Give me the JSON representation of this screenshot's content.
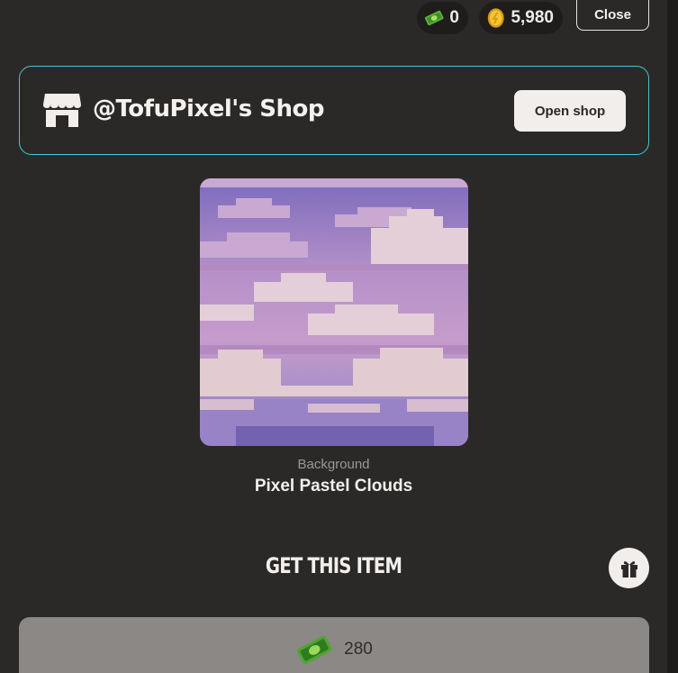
{
  "header": {
    "cash_balance": "0",
    "coin_balance": "5,980",
    "close_label": "Close",
    "cash_icon": "cash-note-icon",
    "coin_icon": "gold-coin-icon"
  },
  "shop": {
    "title": "@TofuPixel's Shop",
    "open_label": "Open shop",
    "icon": "storefront-icon"
  },
  "item": {
    "category": "Background",
    "name": "Pixel Pastel Clouds"
  },
  "purchase": {
    "heading": "GET THIS ITEM",
    "price": "280",
    "price_icon": "cash-note-icon",
    "gift_icon": "gift-icon"
  },
  "colors": {
    "background": "#2b2928",
    "shop_border": "#3fc9d6",
    "buy_button": "#8b8886"
  }
}
